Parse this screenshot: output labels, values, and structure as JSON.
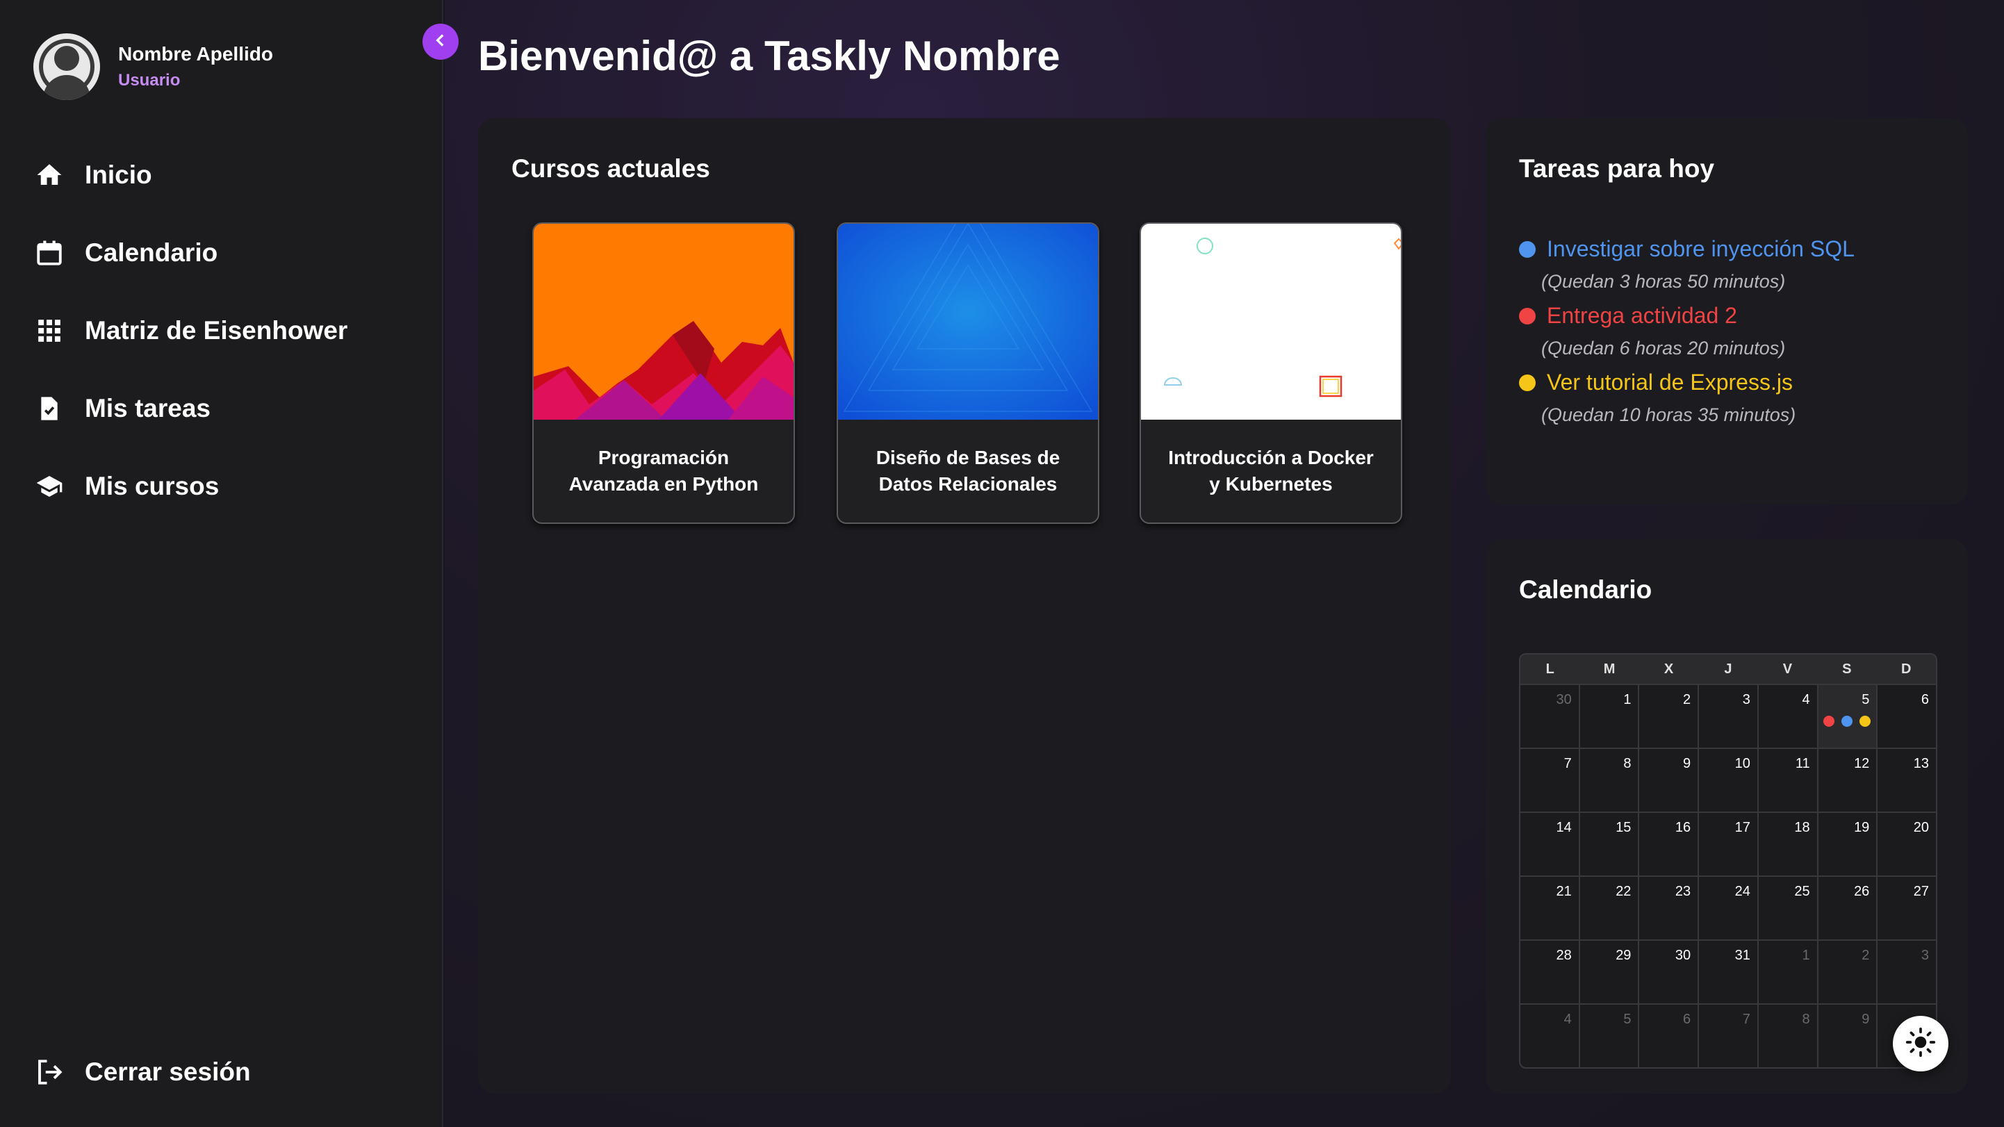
{
  "user": {
    "name": "Nombre Apellido",
    "role": "Usuario"
  },
  "nav": {
    "items": [
      {
        "label": "Inicio",
        "icon": "home-icon"
      },
      {
        "label": "Calendario",
        "icon": "calendar-icon"
      },
      {
        "label": "Matriz de Eisenhower",
        "icon": "grid-icon"
      },
      {
        "label": "Mis tareas",
        "icon": "task-file-icon"
      },
      {
        "label": "Mis cursos",
        "icon": "graduation-cap-icon"
      }
    ],
    "logout_label": "Cerrar sesión"
  },
  "page": {
    "title": "Bienvenid@ a Taskly Nombre"
  },
  "courses": {
    "title": "Cursos actuales",
    "items": [
      {
        "line1": "Programación",
        "line2": "Avanzada en Python"
      },
      {
        "line1": "Diseño de Bases de",
        "line2": "Datos Relacionales"
      },
      {
        "line1": "Introducción a Docker",
        "line2": "y Kubernetes"
      }
    ]
  },
  "tasks": {
    "title": "Tareas para hoy",
    "items": [
      {
        "label": "Investigar sobre inyección SQL",
        "remaining": "(Quedan 3 horas 50 minutos)",
        "color": "#4f95f0"
      },
      {
        "label": "Entrega actividad 2",
        "remaining": "(Quedan 6 horas 20 minutos)",
        "color": "#f04343"
      },
      {
        "label": "Ver tutorial de Express.js",
        "remaining": "(Quedan 10 horas 35 minutos)",
        "color": "#f5c518"
      }
    ]
  },
  "calendar": {
    "title": "Calendario",
    "weekdays": [
      "L",
      "M",
      "X",
      "J",
      "V",
      "S",
      "D"
    ],
    "weeks": [
      [
        "30",
        "1",
        "2",
        "3",
        "4",
        "5",
        "6"
      ],
      [
        "7",
        "8",
        "9",
        "10",
        "11",
        "12",
        "13"
      ],
      [
        "14",
        "15",
        "16",
        "17",
        "18",
        "19",
        "20"
      ],
      [
        "21",
        "22",
        "23",
        "24",
        "25",
        "26",
        "27"
      ],
      [
        "28",
        "29",
        "30",
        "31",
        "1",
        "2",
        "3"
      ],
      [
        "4",
        "5",
        "6",
        "7",
        "8",
        "9",
        ""
      ]
    ],
    "event_colors": [
      "#f04343",
      "#4f95f0",
      "#f5c518"
    ]
  },
  "colors": {
    "accent": "#a03ff0",
    "role": "#c58cf2",
    "course_orange": "#ff7a00",
    "course_blue": "#1565e0"
  }
}
